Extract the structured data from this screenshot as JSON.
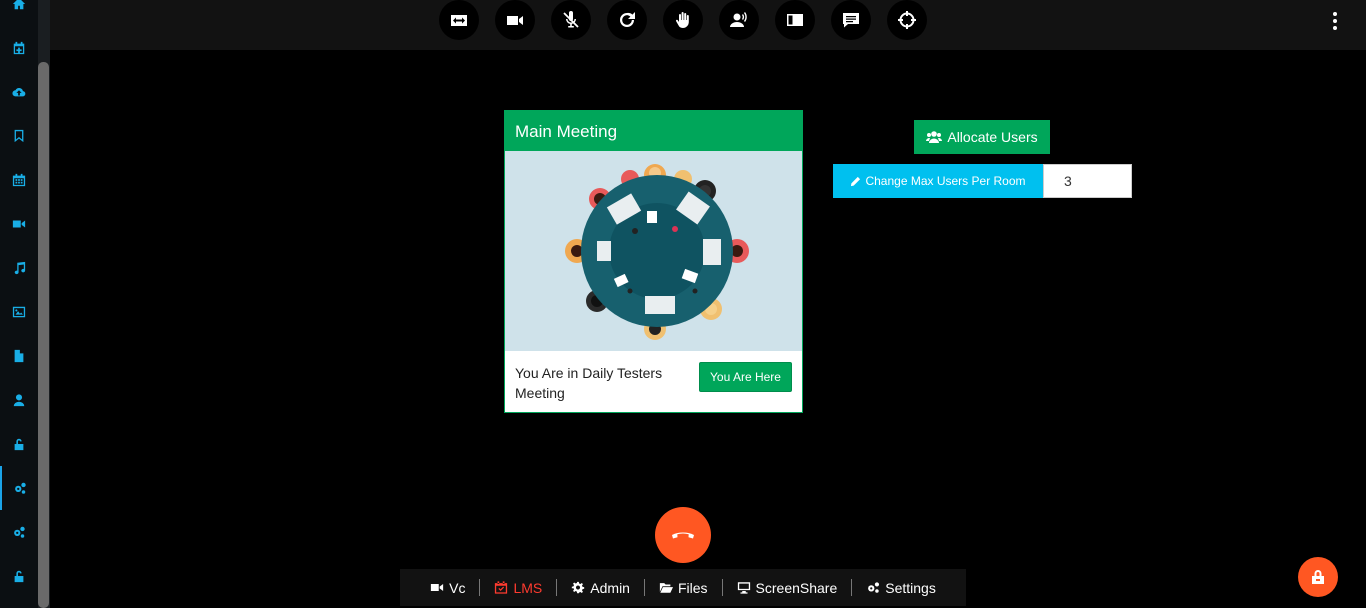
{
  "sidebar": {
    "items": [
      {
        "icon": "home-icon"
      },
      {
        "icon": "calendar-plus-icon"
      },
      {
        "icon": "cloud-upload-icon"
      },
      {
        "icon": "bookmark-icon"
      },
      {
        "icon": "calendar-icon"
      },
      {
        "icon": "video-camera-icon"
      },
      {
        "icon": "music-icon"
      },
      {
        "icon": "image-icon"
      },
      {
        "icon": "file-icon"
      },
      {
        "icon": "user-icon"
      },
      {
        "icon": "unlock-icon"
      },
      {
        "icon": "cogs-icon",
        "active": true
      },
      {
        "icon": "cogs-icon"
      },
      {
        "icon": "unlock-icon"
      }
    ]
  },
  "toolbar": {
    "buttons": [
      {
        "icon": "switch-camera-icon"
      },
      {
        "icon": "video-camera-icon"
      },
      {
        "icon": "microphone-muted-icon"
      },
      {
        "icon": "refresh-icon"
      },
      {
        "icon": "raise-hand-icon"
      },
      {
        "icon": "speaker-user-icon"
      },
      {
        "icon": "picture-in-picture-icon"
      },
      {
        "icon": "chat-icon"
      },
      {
        "icon": "crosshair-icon"
      }
    ]
  },
  "meeting_card": {
    "title": "Main Meeting",
    "status_text": "You Are in Daily Testers Meeting",
    "button_label": "You Are Here"
  },
  "controls": {
    "allocate_label": "Allocate Users",
    "change_max_label": "Change Max Users Per Room",
    "max_users_value": "3"
  },
  "bottom_nav": {
    "items": [
      {
        "label": "Vc",
        "icon": "video-camera-icon"
      },
      {
        "label": "LMS",
        "icon": "calendar-check-icon",
        "active": true
      },
      {
        "label": "Admin",
        "icon": "gear-icon"
      },
      {
        "label": "Files",
        "icon": "folder-open-icon"
      },
      {
        "label": "ScreenShare",
        "icon": "monitor-icon"
      },
      {
        "label": "Settings",
        "icon": "cogs-icon"
      }
    ]
  },
  "colors": {
    "accent_green": "#00a65a",
    "accent_cyan": "#00c0ef",
    "accent_orange": "#ff5722",
    "sidebar_icon": "#19aee6",
    "active_nav": "#ff3b2f"
  }
}
